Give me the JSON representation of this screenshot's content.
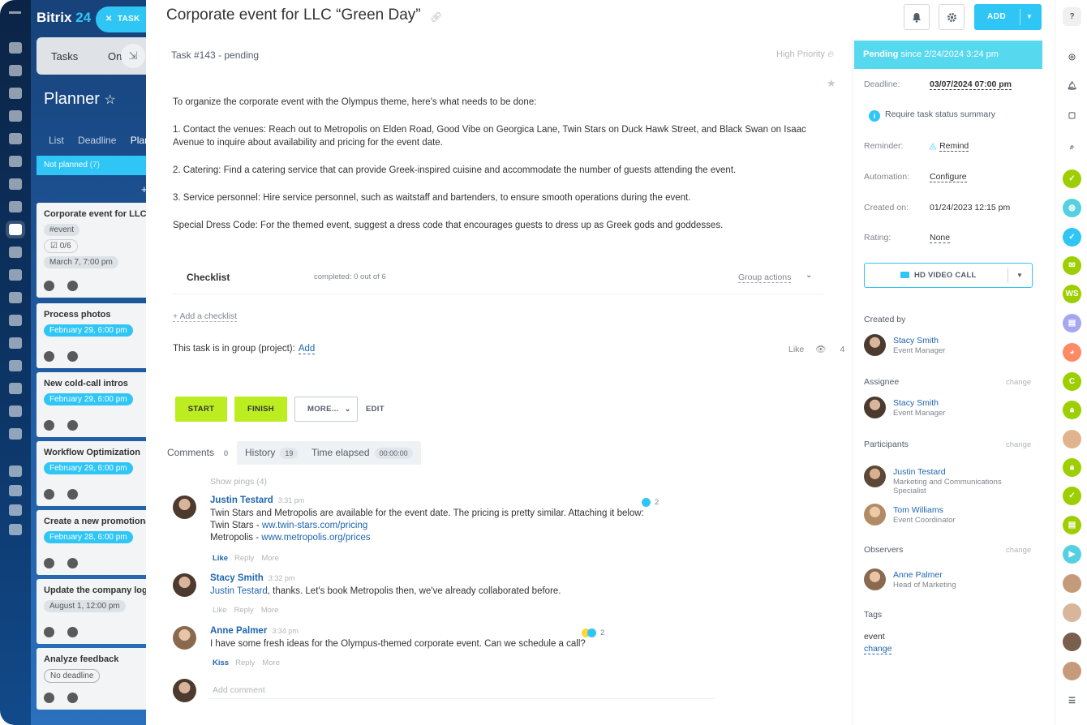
{
  "rail": {
    "icon_count": 20
  },
  "planner": {
    "brand": "Bitrix",
    "brand_num": "24",
    "task_button": "TASK",
    "tabs": [
      "Tasks",
      "On"
    ],
    "title": "Planner",
    "views": [
      "List",
      "Deadline",
      "Plan"
    ],
    "column_label": "Not planned",
    "column_count": "(7)",
    "cards": [
      {
        "title": "Corporate event for LLC “Green Day”",
        "tag": "#event",
        "check": "0/6",
        "due": "March 7, 7:00 pm",
        "due_style": "gray"
      },
      {
        "title": "Process photos",
        "due": "February 29, 6:00 pm",
        "due_style": "blue"
      },
      {
        "title": "New cold-call intros",
        "due": "February 29, 6:00 pm",
        "due_style": "blue"
      },
      {
        "title": "Workflow Optimization",
        "due": "February 29, 6:00 pm",
        "due_style": "blue"
      },
      {
        "title": "Create a new promotional",
        "due": "February 28, 6:00 pm",
        "due_style": "blue"
      },
      {
        "title": "Update the company logo",
        "due": "August 1, 12:00 pm",
        "due_style": "gray"
      },
      {
        "title": "Analyze feedback",
        "due": "No deadline",
        "due_style": "outline"
      }
    ]
  },
  "task": {
    "title": "Corporate event for LLC “Green Day”",
    "add_button": "ADD",
    "number_status": "Task #143 - pending",
    "priority": "High Priority",
    "description": [
      "To organize the corporate event with the Olympus theme, here's what needs to be done:",
      "1. Contact the venues: Reach out to Metropolis on Elden Road, Good Vibe on Georgica Lane, Twin Stars on Duck Hawk Street, and Black Swan on Isaac Avenue to inquire about availability and pricing for the event date.",
      "2. Catering: Find a catering service that can provide Greek-inspired cuisine and accommodate the number of guests attending the event.",
      "3. Service personnel: Hire service personnel, such as waitstaff and bartenders, to ensure smooth operations during the event.",
      "Special Dress Code: For the themed event, suggest a dress code that encourages guests to dress up as Greek gods and goddesses."
    ],
    "checklist": {
      "title": "Checklist",
      "status": "completed: 0 out of 6",
      "group_actions": "Group actions",
      "add_label": "+ Add a checklist"
    },
    "group_text": "This task is in group (project):",
    "group_add": "Add",
    "like": "Like",
    "views": "4",
    "buttons": {
      "start": "START",
      "finish": "FINISH",
      "more": "MORE...",
      "edit": "EDIT"
    },
    "tabs": {
      "comments": "Comments",
      "comments_count": "0",
      "history": "History",
      "history_count": "19",
      "time": "Time elapsed",
      "time_value": "00:00:00"
    },
    "show_pings": "Show pings (4)",
    "comments": [
      {
        "author": "Justin Testard",
        "time": "3:31 pm",
        "line1": "Twin Stars and Metropolis are available for the event date. The pricing is pretty similar. Attaching it below:",
        "line2_label": "Twin Stars - ",
        "line2_link": "ww.twin-stars.com/pricing",
        "line3_label": "Metropolis - ",
        "line3_link": "www.metropolis.org/prices",
        "action1": "Like",
        "action2": "Reply",
        "action3": "More",
        "reactions": "2"
      },
      {
        "author": "Stacy Smith",
        "time": "3:32 pm",
        "mention": "Justin Testard",
        "text": ", thanks. Let's book Metropolis then, we've already collaborated before.",
        "action1": "Like",
        "action2": "Reply",
        "action3": "More"
      },
      {
        "author": "Anne Palmer",
        "time": "3:34 pm",
        "text": "I have some fresh ideas for the Olympus-themed corporate event. Can we schedule a call?",
        "action1": "Kiss",
        "action2": "Reply",
        "action3": "More",
        "reactions": "2"
      }
    ],
    "add_comment_placeholder": "Add comment"
  },
  "side": {
    "pending_label": "Pending",
    "pending_since": "since 2/24/2024 3:24 pm",
    "deadline_label": "Deadline:",
    "deadline_value": "03/07/2024 07:00 pm",
    "summary": "Require task status summary",
    "reminder_label": "Reminder:",
    "reminder_value": "Remind",
    "automation_label": "Automation:",
    "automation_value": "Configure",
    "created_label": "Created on:",
    "created_value": "01/24/2023 12:15 pm",
    "rating_label": "Rating:",
    "rating_value": "None",
    "video_call": "HD VIDEO CALL",
    "created_by_label": "Created by",
    "created_by": {
      "name": "Stacy Smith",
      "role": "Event Manager"
    },
    "assignee_label": "Assignee",
    "assignee": {
      "name": "Stacy Smith",
      "role": "Event Manager"
    },
    "participants_label": "Participants",
    "participants": [
      {
        "name": "Justin Testard",
        "role": "Marketing and Communications Specialist"
      },
      {
        "name": "Tom Williams",
        "role": "Event Coordinator"
      }
    ],
    "observers_label": "Observers",
    "observer": {
      "name": "Anne Palmer",
      "role": "Head of Marketing"
    },
    "change": "change",
    "tags_label": "Tags",
    "tag": "event",
    "tag_change": "change"
  },
  "rbar": {
    "letters": {
      "ws": "WS",
      "c": "C"
    },
    "colors": {
      "green": "#9dcf00",
      "blue": "#2fc6f6",
      "purple": "#a5a8f0",
      "orange": "#ff8a65",
      "teal": "#55d0e0"
    }
  },
  "colors": {
    "accent": "#2fc6f6",
    "action_green": "#bbed21",
    "link": "#2066b0"
  }
}
